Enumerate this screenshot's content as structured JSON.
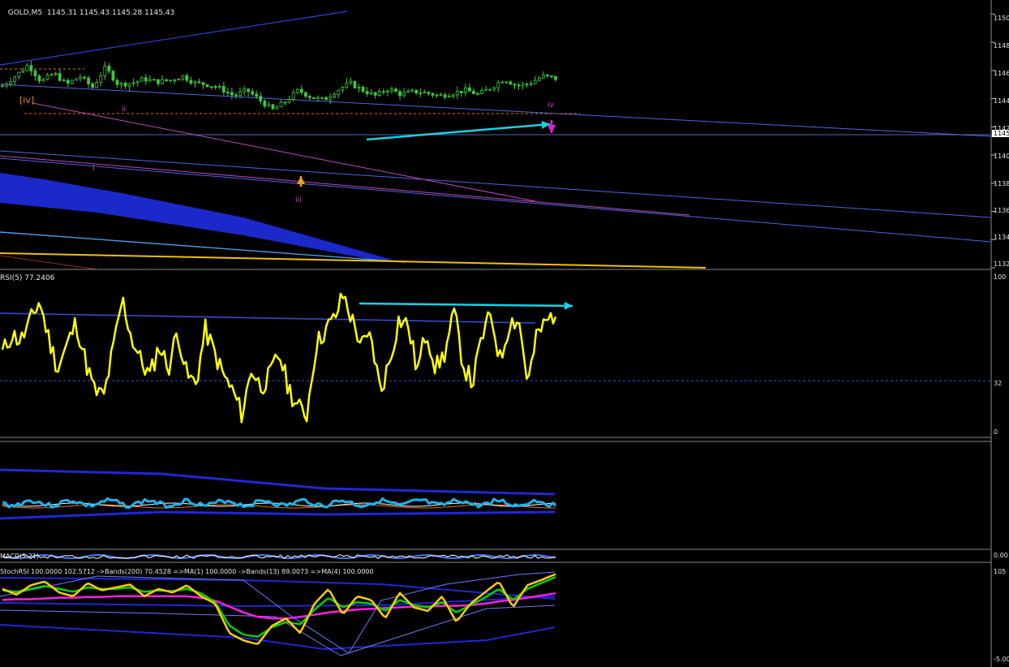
{
  "main_panel": {
    "symbol_label": "GOLD,M5",
    "ohlc": "1145.31 1145.43 1145.28 1145.43",
    "price_ticks": [
      "1150",
      "1148",
      "1146",
      "1144",
      "1142",
      "1140",
      "1138",
      "1136",
      "1134",
      "1132"
    ],
    "current_price_marker": "1145",
    "wave_labels": [
      "[iv]",
      "ii",
      "iii",
      "iv",
      "i"
    ],
    "colors": {
      "bull_candle": "#3cc83c",
      "bear_candle": "#3cc83c",
      "arrow": "#19d2e6",
      "wave_label_iv_bracket": "#e08a1c",
      "wave_label": "#c84ac8",
      "channel": "#3a4ee0"
    }
  },
  "rsi_panel": {
    "title": "RSI(5) 77.2406",
    "levels": [
      "100",
      "32",
      "0"
    ],
    "colors": {
      "line": "#ffff00",
      "arrow": "#19d2e6",
      "level": "#3a4ee0"
    }
  },
  "ma_panel": {
    "title": "",
    "colors": {
      "band": "#1e28d8",
      "line": "#19b4f0"
    }
  },
  "macd_panel": {
    "title": "MACD(5,21)",
    "values": "0.00",
    "colors": {
      "line": "#ffffff",
      "signal": "#3c78ff"
    }
  },
  "stoch_panel": {
    "title": "StochRSI 100.0000 102.5712 ->Bands(200) 70.4528 =>MA(1) 100.0000 ->Bands(13) 89.0073 =>MA(4) 100.0000",
    "levels": [
      "105",
      "-5.00"
    ],
    "colors": {
      "fast": "#ffcc00",
      "slow": "#00d000",
      "ma": "#ff1ee6",
      "band": "#1e28d8",
      "thin_band": "#6a7cff"
    }
  },
  "chart_data": [
    {
      "type": "candlestick",
      "title": "GOLD,M5",
      "ylim": [
        1132,
        1151
      ],
      "y_ticks": [
        1150,
        1148,
        1146,
        1144,
        1142,
        1140,
        1138,
        1136,
        1134,
        1132
      ],
      "close_path": [
        1144.9,
        1145.6,
        1146.4,
        1145.2,
        1145.8,
        1145.0,
        1145.6,
        1144.8,
        1146.2,
        1145.0,
        1145.1,
        1145.4,
        1145.2,
        1145.3,
        1145.6,
        1145.1,
        1145.0,
        1144.7,
        1144.2,
        1144.6,
        1143.9,
        1143.2,
        1143.8,
        1144.6,
        1144.1,
        1143.9,
        1144.6,
        1145.1,
        1144.6,
        1144.2,
        1144.7,
        1144.3,
        1144.5,
        1144.4,
        1144.2,
        1144.4,
        1144.6,
        1144.3,
        1144.8,
        1145.4,
        1144.9,
        1145.1,
        1145.6,
        1145.43
      ]
    },
    {
      "type": "line",
      "title": "RSI(5) 77.2406",
      "ylim": [
        0,
        100
      ],
      "levels": [
        32
      ],
      "series": [
        {
          "name": "RSI(5)",
          "values": [
            50,
            62,
            58,
            70,
            84,
            60,
            40,
            55,
            70,
            45,
            25,
            22,
            52,
            85,
            60,
            45,
            35,
            55,
            40,
            65,
            35,
            30,
            65,
            50,
            35,
            25,
            10,
            40,
            28,
            35,
            50,
            28,
            15,
            10,
            55,
            65,
            72,
            88,
            70,
            55,
            60,
            25,
            45,
            72,
            68,
            38,
            65,
            40,
            50,
            76,
            42,
            30,
            60,
            75,
            45,
            70,
            72,
            30,
            62,
            70,
            77
          ]
        }
      ]
    },
    {
      "type": "line",
      "title": "StochRSI",
      "ylim": [
        -5,
        105
      ],
      "series": [
        {
          "name": "StochRSI",
          "values": [
            80,
            72,
            85,
            90,
            75,
            70,
            88,
            78,
            82,
            86,
            70,
            80,
            75,
            85,
            70,
            60,
            20,
            10,
            5,
            30,
            40,
            20,
            60,
            80,
            45,
            70,
            65,
            40,
            75,
            55,
            50,
            70,
            35,
            60,
            75,
            90,
            55,
            85,
            92,
            100
          ]
        },
        {
          "name": "MA(4)",
          "values": [
            78,
            76,
            80,
            84,
            80,
            76,
            82,
            80,
            80,
            82,
            76,
            78,
            77,
            80,
            74,
            62,
            30,
            18,
            15,
            28,
            35,
            32,
            52,
            68,
            55,
            62,
            60,
            50,
            65,
            58,
            55,
            62,
            48,
            58,
            68,
            80,
            65,
            80,
            88,
            96
          ]
        },
        {
          "name": "MA(1)",
          "values": [
            65,
            66,
            66,
            67,
            68,
            68,
            69,
            69,
            70,
            70,
            70,
            70,
            70,
            70,
            68,
            64,
            56,
            48,
            42,
            40,
            40,
            42,
            45,
            48,
            50,
            52,
            53,
            54,
            55,
            56,
            56,
            57,
            57,
            58,
            60,
            63,
            65,
            68,
            71,
            74
          ]
        }
      ]
    }
  ]
}
